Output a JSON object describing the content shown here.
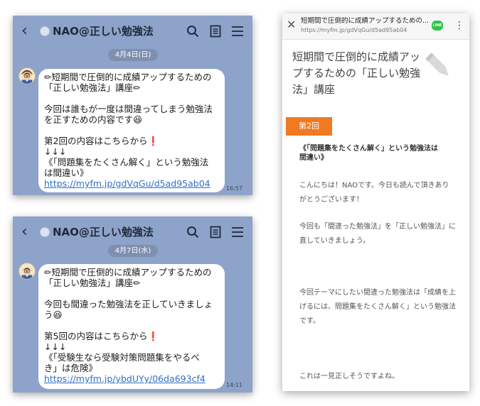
{
  "chat1": {
    "title": "NAO@正しい勉強法",
    "date": "4月4日(日)",
    "lines": [
      "✏短期間で圧倒的に成績アップするための",
      "「正しい勉強法」講座✏",
      "",
      "今回は誰もが一度は間違ってしまう勉強法",
      "を正すための内容です😆",
      "",
      "第2回の内容はこちらから❗",
      "↓↓↓",
      "《「問題集をたくさん解く」という勉強法",
      "は間違い》"
    ],
    "link": "https://myfm.jp/gdVqGu/d5ad95ab04",
    "time": "16:57"
  },
  "chat2": {
    "title": "NAO@正しい勉強法",
    "date": "4月7日(水)",
    "lines": [
      "✏短期間で圧倒的に成績アップするための",
      "「正しい勉強法」講座✏",
      "",
      "今回も間違った勉強法を正していきましょ",
      "う😆",
      "",
      "第5回の内容はこちらから❗",
      "↓↓↓",
      "《「受験生なら受験対策問題集をやるべ",
      "き」は危険》"
    ],
    "link": "https://myfm.jp/ybdUYy/06da693cf4",
    "time": "14:11"
  },
  "browser": {
    "page_title": "短期間で圧倒的に成績アップするための...",
    "url": "https://myfm.jp/gdVqGu/d5ad95ab04",
    "line_label": "LINE",
    "heading": "短期間で圧倒的に成績アップするための「正しい勉強法」講座",
    "section_badge": "第2回",
    "section_heading": "《「問題集をたくさん解く」という勉強法は\n間違い》",
    "para1": "こんにちは！NAOです。今日も読んで頂きありがとうございます！",
    "para2": "今回も「間違った勉強法」を「正しい勉強法」に直していきましょう。",
    "para3": "今回テーマにしたい間違った勉強法は「成績を上げるには、問題集をたくさん解く」という勉強法です。",
    "para4": "これは一見正しそうですよね。"
  },
  "colors": {
    "chat_bg": "#8ea3c9",
    "link": "#2f6fc7",
    "badge": "#f07a21",
    "line_green": "#2ec54a"
  }
}
